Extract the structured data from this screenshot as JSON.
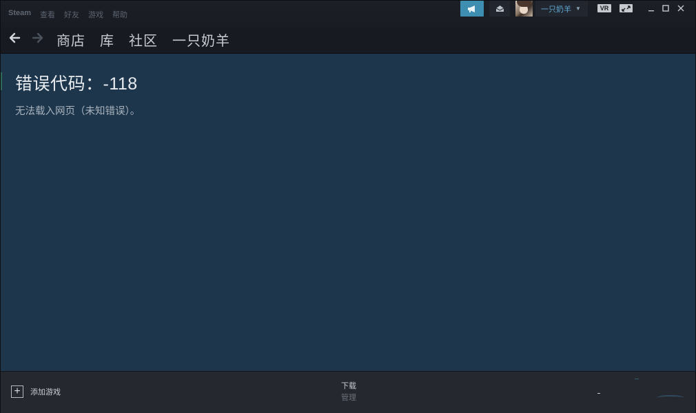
{
  "menu": {
    "items": [
      "Steam",
      "查看",
      "好友",
      "游戏",
      "帮助"
    ]
  },
  "titlebar": {
    "username": "一只奶羊",
    "vr_label": "VR"
  },
  "nav": {
    "links": [
      "商店",
      "库",
      "社区",
      "一只奶羊"
    ]
  },
  "content": {
    "error_title": "错误代码：-118",
    "error_message": "无法载入网页（未知错误）。"
  },
  "bottom": {
    "add_game_label": "添加游戏",
    "downloads_title": "下载",
    "downloads_sub": "管理"
  },
  "colors": {
    "content_bg": "#1d364c",
    "accent": "#3d8eb0",
    "username_color": "#5fa8d3"
  }
}
